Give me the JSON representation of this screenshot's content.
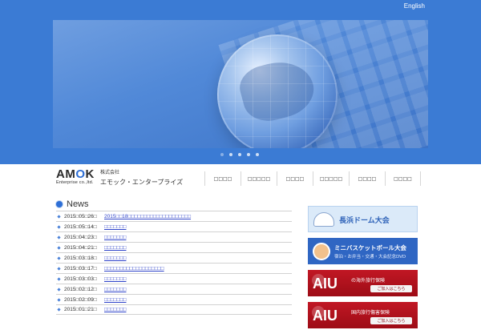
{
  "header": {
    "language_link": "English"
  },
  "hero": {
    "slides_count": 5,
    "active_slide_index": 0
  },
  "branding": {
    "logo_mark": "AMOK",
    "logo_sub": "Enterprise co.,ltd.",
    "company_prefix": "株式会社",
    "company_name": "エモック・エンタープライズ"
  },
  "nav": {
    "items": [
      "□□□□",
      "□□□□□",
      "□□□□",
      "□□□□□",
      "□□□□",
      "□□□□"
    ]
  },
  "news": {
    "title": "News",
    "items": [
      {
        "date": "2015□05□26□",
        "link": "2015□□18□□□□□□□□□□□□□□□□□□□□"
      },
      {
        "date": "2015□05□14□",
        "link": "□□□□□□□"
      },
      {
        "date": "2015□04□23□",
        "link": "□□□□□□□"
      },
      {
        "date": "2015□04□21□",
        "link": "□□□□□□□"
      },
      {
        "date": "2015□03□18□",
        "link": "□□□□□□□"
      },
      {
        "date": "2015□03□17□",
        "link": "□□□□□□□□□□□□□□□□□□□"
      },
      {
        "date": "2015□03□03□",
        "link": "□□□□□□□"
      },
      {
        "date": "2015□02□12□",
        "link": "□□□□□□□"
      },
      {
        "date": "2015□02□09□",
        "link": "□□□□□□□"
      },
      {
        "date": "2015□01□21□",
        "link": "□□□□□□□"
      }
    ]
  },
  "sidebar_banners": {
    "dome": {
      "title": "長浜ドーム大会"
    },
    "basketball": {
      "title": "ミニバスケットボール大会",
      "subtitle": "宿泊・お弁当・交通・大会記念DVD"
    },
    "aiu_overseas": {
      "brand": "AIU",
      "copy": "の海外旅行保険",
      "cta": "ご加入はこちら"
    },
    "aiu_domestic": {
      "brand": "AIU",
      "copy": "国内旅行傷害保険",
      "cta": "ご加入はこちら"
    }
  },
  "colors": {
    "top_blue": "#3b7bd4",
    "accent_blue": "#2e6fd6",
    "link_blue": "#2e43c9",
    "aiu_red": "#c11724"
  }
}
